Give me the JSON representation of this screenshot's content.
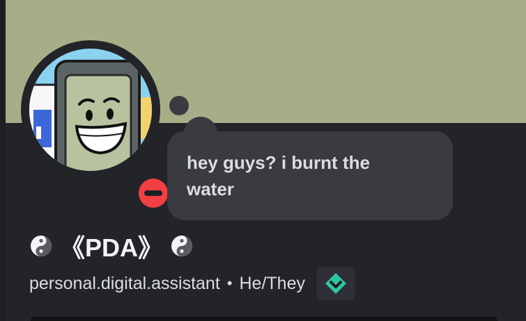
{
  "profile": {
    "custom_status": "hey guys? i burnt the water",
    "display_name": "《PDA》",
    "username": "personal.digital.assistant",
    "separator": "•",
    "pronouns": "He/They",
    "status": "do-not-disturb",
    "name_decoration_icon": "yin-yang-icon",
    "badge_icon": "nitro-gem-badge-icon"
  },
  "colors": {
    "banner": "#a5ae86",
    "card_background": "#232428",
    "bubble_background": "#3a3b41",
    "dnd_red": "#f23f43",
    "badge_teal": "#2dc5a4"
  }
}
